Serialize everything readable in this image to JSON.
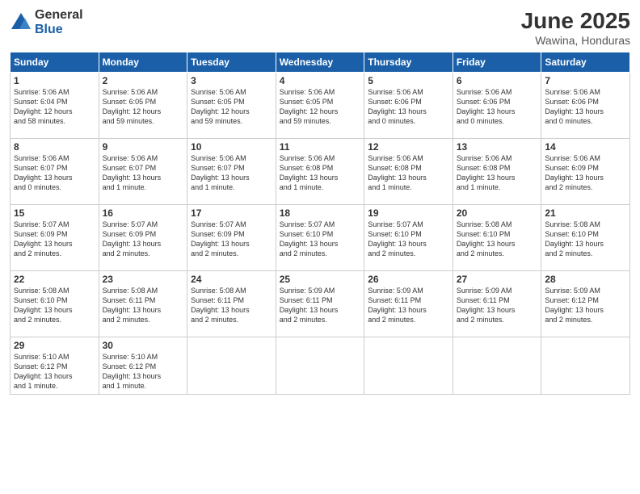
{
  "header": {
    "logo_general": "General",
    "logo_blue": "Blue",
    "month_title": "June 2025",
    "location": "Wawina, Honduras"
  },
  "days_of_week": [
    "Sunday",
    "Monday",
    "Tuesday",
    "Wednesday",
    "Thursday",
    "Friday",
    "Saturday"
  ],
  "weeks": [
    [
      {
        "num": "1",
        "sunrise": "5:06 AM",
        "sunset": "6:04 PM",
        "daylight": "12 hours and 58 minutes."
      },
      {
        "num": "2",
        "sunrise": "5:06 AM",
        "sunset": "6:05 PM",
        "daylight": "12 hours and 59 minutes."
      },
      {
        "num": "3",
        "sunrise": "5:06 AM",
        "sunset": "6:05 PM",
        "daylight": "12 hours and 59 minutes."
      },
      {
        "num": "4",
        "sunrise": "5:06 AM",
        "sunset": "6:05 PM",
        "daylight": "12 hours and 59 minutes."
      },
      {
        "num": "5",
        "sunrise": "5:06 AM",
        "sunset": "6:06 PM",
        "daylight": "13 hours and 0 minutes."
      },
      {
        "num": "6",
        "sunrise": "5:06 AM",
        "sunset": "6:06 PM",
        "daylight": "13 hours and 0 minutes."
      },
      {
        "num": "7",
        "sunrise": "5:06 AM",
        "sunset": "6:06 PM",
        "daylight": "13 hours and 0 minutes."
      }
    ],
    [
      {
        "num": "8",
        "sunrise": "5:06 AM",
        "sunset": "6:07 PM",
        "daylight": "13 hours and 0 minutes."
      },
      {
        "num": "9",
        "sunrise": "5:06 AM",
        "sunset": "6:07 PM",
        "daylight": "13 hours and 1 minute."
      },
      {
        "num": "10",
        "sunrise": "5:06 AM",
        "sunset": "6:07 PM",
        "daylight": "13 hours and 1 minute."
      },
      {
        "num": "11",
        "sunrise": "5:06 AM",
        "sunset": "6:08 PM",
        "daylight": "13 hours and 1 minute."
      },
      {
        "num": "12",
        "sunrise": "5:06 AM",
        "sunset": "6:08 PM",
        "daylight": "13 hours and 1 minute."
      },
      {
        "num": "13",
        "sunrise": "5:06 AM",
        "sunset": "6:08 PM",
        "daylight": "13 hours and 1 minute."
      },
      {
        "num": "14",
        "sunrise": "5:06 AM",
        "sunset": "6:09 PM",
        "daylight": "13 hours and 2 minutes."
      }
    ],
    [
      {
        "num": "15",
        "sunrise": "5:07 AM",
        "sunset": "6:09 PM",
        "daylight": "13 hours and 2 minutes."
      },
      {
        "num": "16",
        "sunrise": "5:07 AM",
        "sunset": "6:09 PM",
        "daylight": "13 hours and 2 minutes."
      },
      {
        "num": "17",
        "sunrise": "5:07 AM",
        "sunset": "6:09 PM",
        "daylight": "13 hours and 2 minutes."
      },
      {
        "num": "18",
        "sunrise": "5:07 AM",
        "sunset": "6:10 PM",
        "daylight": "13 hours and 2 minutes."
      },
      {
        "num": "19",
        "sunrise": "5:07 AM",
        "sunset": "6:10 PM",
        "daylight": "13 hours and 2 minutes."
      },
      {
        "num": "20",
        "sunrise": "5:08 AM",
        "sunset": "6:10 PM",
        "daylight": "13 hours and 2 minutes."
      },
      {
        "num": "21",
        "sunrise": "5:08 AM",
        "sunset": "6:10 PM",
        "daylight": "13 hours and 2 minutes."
      }
    ],
    [
      {
        "num": "22",
        "sunrise": "5:08 AM",
        "sunset": "6:10 PM",
        "daylight": "13 hours and 2 minutes."
      },
      {
        "num": "23",
        "sunrise": "5:08 AM",
        "sunset": "6:11 PM",
        "daylight": "13 hours and 2 minutes."
      },
      {
        "num": "24",
        "sunrise": "5:08 AM",
        "sunset": "6:11 PM",
        "daylight": "13 hours and 2 minutes."
      },
      {
        "num": "25",
        "sunrise": "5:09 AM",
        "sunset": "6:11 PM",
        "daylight": "13 hours and 2 minutes."
      },
      {
        "num": "26",
        "sunrise": "5:09 AM",
        "sunset": "6:11 PM",
        "daylight": "13 hours and 2 minutes."
      },
      {
        "num": "27",
        "sunrise": "5:09 AM",
        "sunset": "6:11 PM",
        "daylight": "13 hours and 2 minutes."
      },
      {
        "num": "28",
        "sunrise": "5:09 AM",
        "sunset": "6:12 PM",
        "daylight": "13 hours and 2 minutes."
      }
    ],
    [
      {
        "num": "29",
        "sunrise": "5:10 AM",
        "sunset": "6:12 PM",
        "daylight": "13 hours and 1 minute."
      },
      {
        "num": "30",
        "sunrise": "5:10 AM",
        "sunset": "6:12 PM",
        "daylight": "13 hours and 1 minute."
      },
      null,
      null,
      null,
      null,
      null
    ]
  ]
}
